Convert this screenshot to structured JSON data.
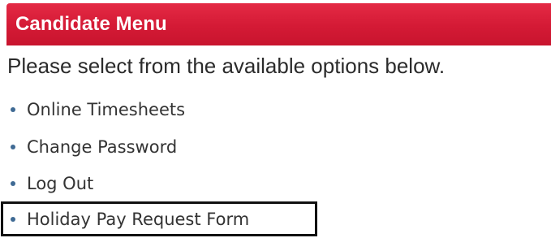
{
  "header": {
    "title": "Candidate Menu",
    "background_color": "#d41a35",
    "text_color": "#ffffff"
  },
  "intro_text": "Please select from the available options below.",
  "menu": {
    "bullet_color": "#3f6a94",
    "items": [
      {
        "label": "Online Timesheets"
      },
      {
        "label": "Change Password"
      },
      {
        "label": "Log Out"
      },
      {
        "label": "Holiday Pay Request Form",
        "highlighted": true
      }
    ]
  }
}
